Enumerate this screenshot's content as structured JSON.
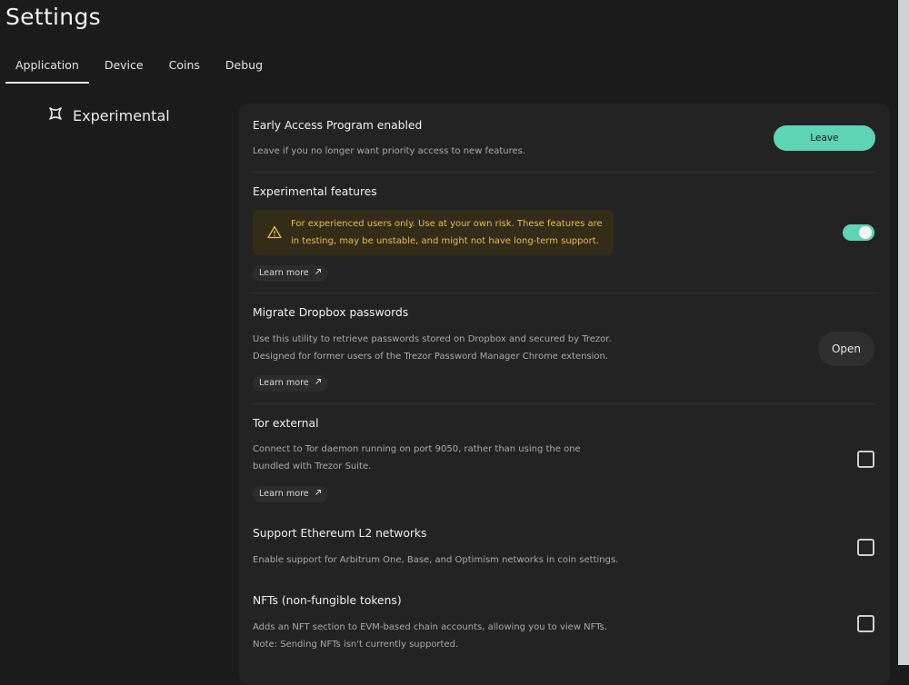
{
  "page": {
    "title": "Settings"
  },
  "tabs": [
    {
      "label": "Application",
      "active": true
    },
    {
      "label": "Device",
      "active": false
    },
    {
      "label": "Coins",
      "active": false
    },
    {
      "label": "Debug",
      "active": false
    }
  ],
  "section": {
    "label": "Experimental",
    "icon": "experimental-icon"
  },
  "settings": {
    "early_access": {
      "title": "Early Access Program enabled",
      "description": "Leave if you no longer want priority access to new features.",
      "button": "Leave"
    },
    "experimental_features": {
      "title": "Experimental features",
      "warning": "For experienced users only. Use at your own risk. These features are in testing, may be unstable, and might not have long-term support.",
      "learn_more": "Learn more",
      "enabled": true
    },
    "migrate_dropbox": {
      "title": "Migrate Dropbox passwords",
      "description": "Use this utility to retrieve passwords stored on Dropbox and secured by Trezor. Designed for former users of the Trezor Password Manager Chrome extension.",
      "learn_more": "Learn more",
      "button": "Open"
    },
    "tor_external": {
      "title": "Tor external",
      "description": "Connect to Tor daemon running on port 9050, rather than using the one bundled with Trezor Suite.",
      "learn_more": "Learn more",
      "checked": false
    },
    "ethereum_l2": {
      "title": "Support Ethereum L2 networks",
      "description": "Enable support for Arbitrum One, Base, and Optimism networks in coin settings.",
      "checked": false
    },
    "nfts": {
      "title": "NFTs (non-fungible tokens)",
      "description_line1": "Adds an NFT section to EVM-based chain accounts, allowing you to view NFTs.",
      "description_line2": "Note: Sending NFTs isn't currently supported.",
      "checked": false
    }
  },
  "colors": {
    "accent": "#5ed4b4",
    "warning_text": "#e9bd4c",
    "warning_bg": "#332c19"
  }
}
